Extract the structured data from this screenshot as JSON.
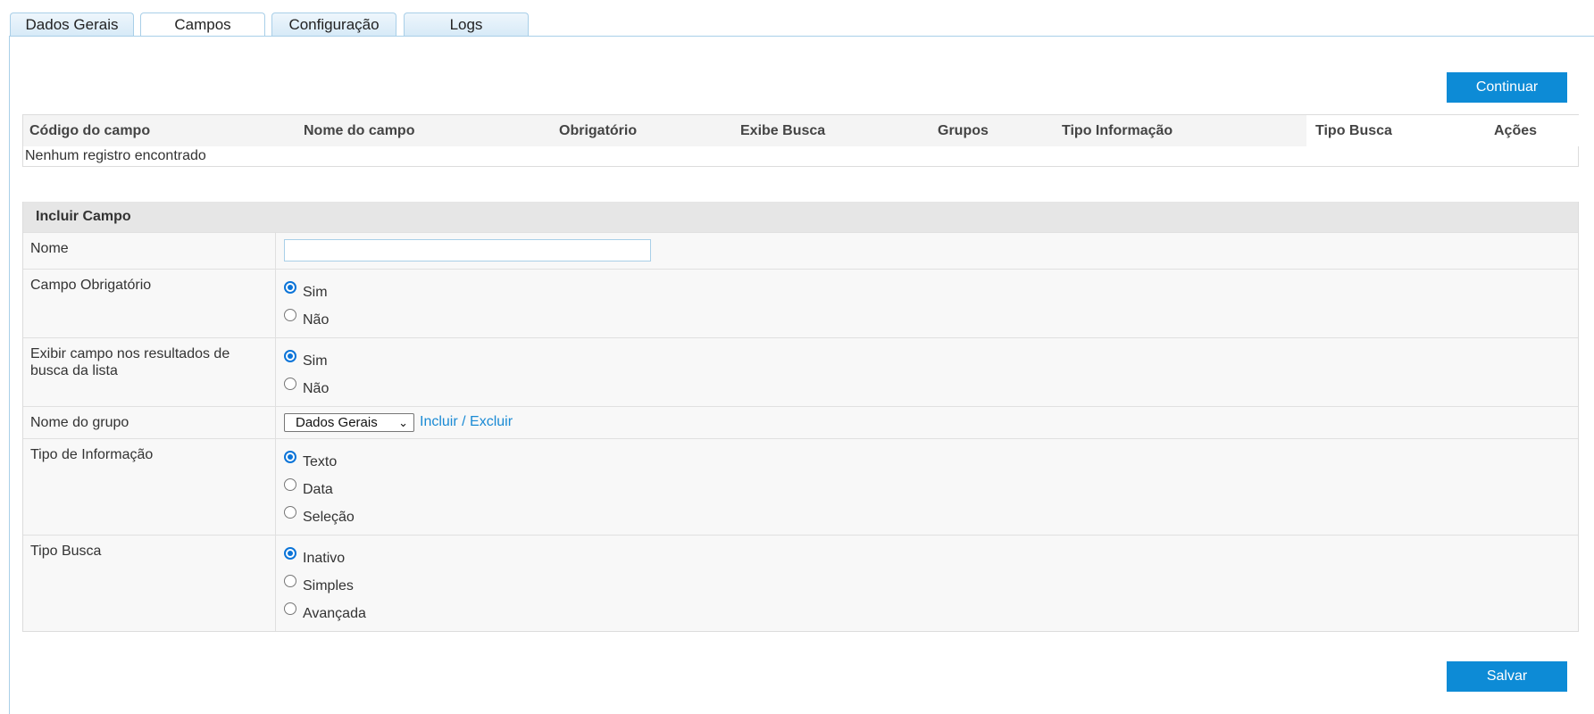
{
  "tabs": [
    {
      "label": "Dados Gerais"
    },
    {
      "label": "Campos"
    },
    {
      "label": "Configuração"
    },
    {
      "label": "Logs"
    }
  ],
  "toolbar": {
    "continue_label": "Continuar"
  },
  "grid": {
    "columns": [
      "Código do campo",
      "Nome do campo",
      "Obrigatório",
      "Exibe Busca",
      "Grupos",
      "Tipo Informação",
      "Tipo Busca",
      "Ações"
    ],
    "empty_message": "Nenhum registro encontrado"
  },
  "form": {
    "title": "Incluir Campo",
    "nome": {
      "label": "Nome",
      "value": ""
    },
    "obrigatorio": {
      "label": "Campo Obrigatório",
      "options": [
        "Sim",
        "Não"
      ],
      "selected": "Sim"
    },
    "exibir": {
      "label": "Exibir campo nos resultados de busca da lista",
      "options": [
        "Sim",
        "Não"
      ],
      "selected": "Sim"
    },
    "grupo": {
      "label": "Nome do grupo",
      "selected": "Dados Gerais",
      "link": "Incluir / Excluir"
    },
    "tipo_info": {
      "label": "Tipo de Informação",
      "options": [
        "Texto",
        "Data",
        "Seleção"
      ],
      "selected": "Texto"
    },
    "tipo_busca": {
      "label": "Tipo Busca",
      "options": [
        "Inativo",
        "Simples",
        "Avançada"
      ],
      "selected": "Inativo"
    },
    "save_label": "Salvar"
  },
  "colors": {
    "accent": "#0d8bd6",
    "link": "#1a8ad4",
    "radio": "#0b74d8"
  }
}
